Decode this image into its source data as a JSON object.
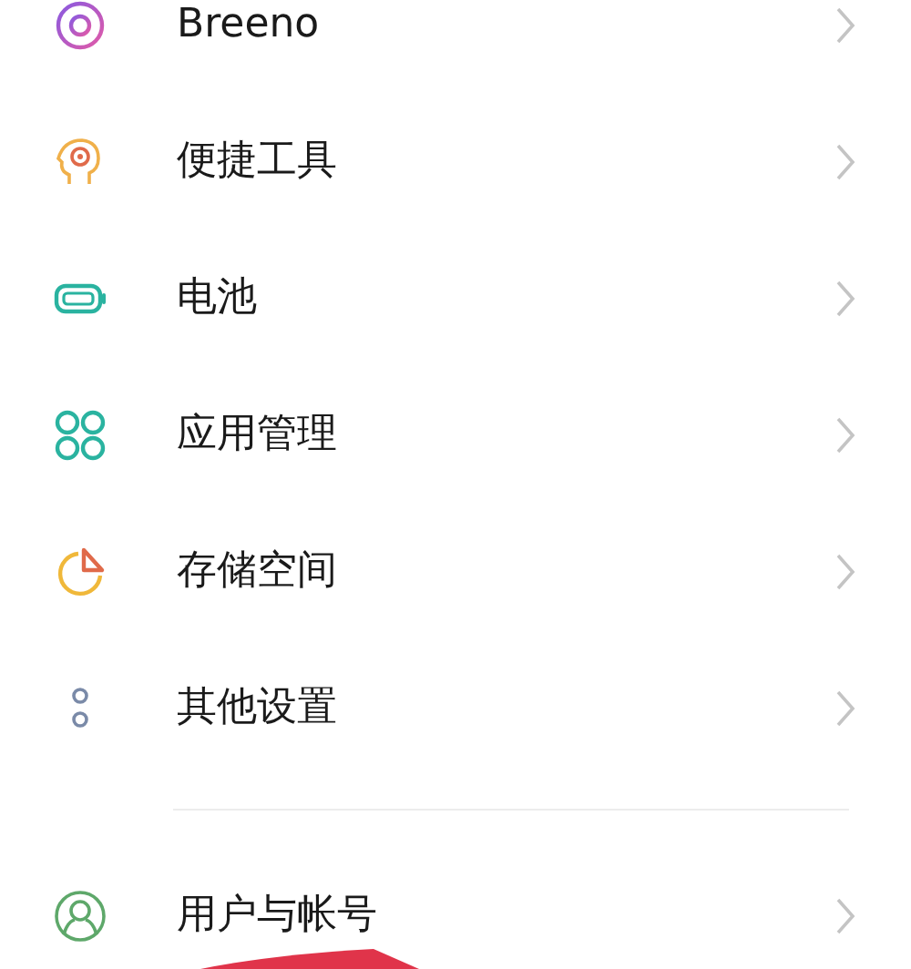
{
  "sections": [
    {
      "items": [
        {
          "kind": "breeno",
          "label": "Breeno"
        },
        {
          "kind": "tools",
          "label": "便捷工具"
        },
        {
          "kind": "battery",
          "label": "电池"
        },
        {
          "kind": "apps",
          "label": "应用管理"
        },
        {
          "kind": "storage",
          "label": "存储空间"
        },
        {
          "kind": "other",
          "label": "其他设置"
        }
      ]
    },
    {
      "items": [
        {
          "kind": "account",
          "label": "用户与帐号"
        }
      ]
    }
  ]
}
